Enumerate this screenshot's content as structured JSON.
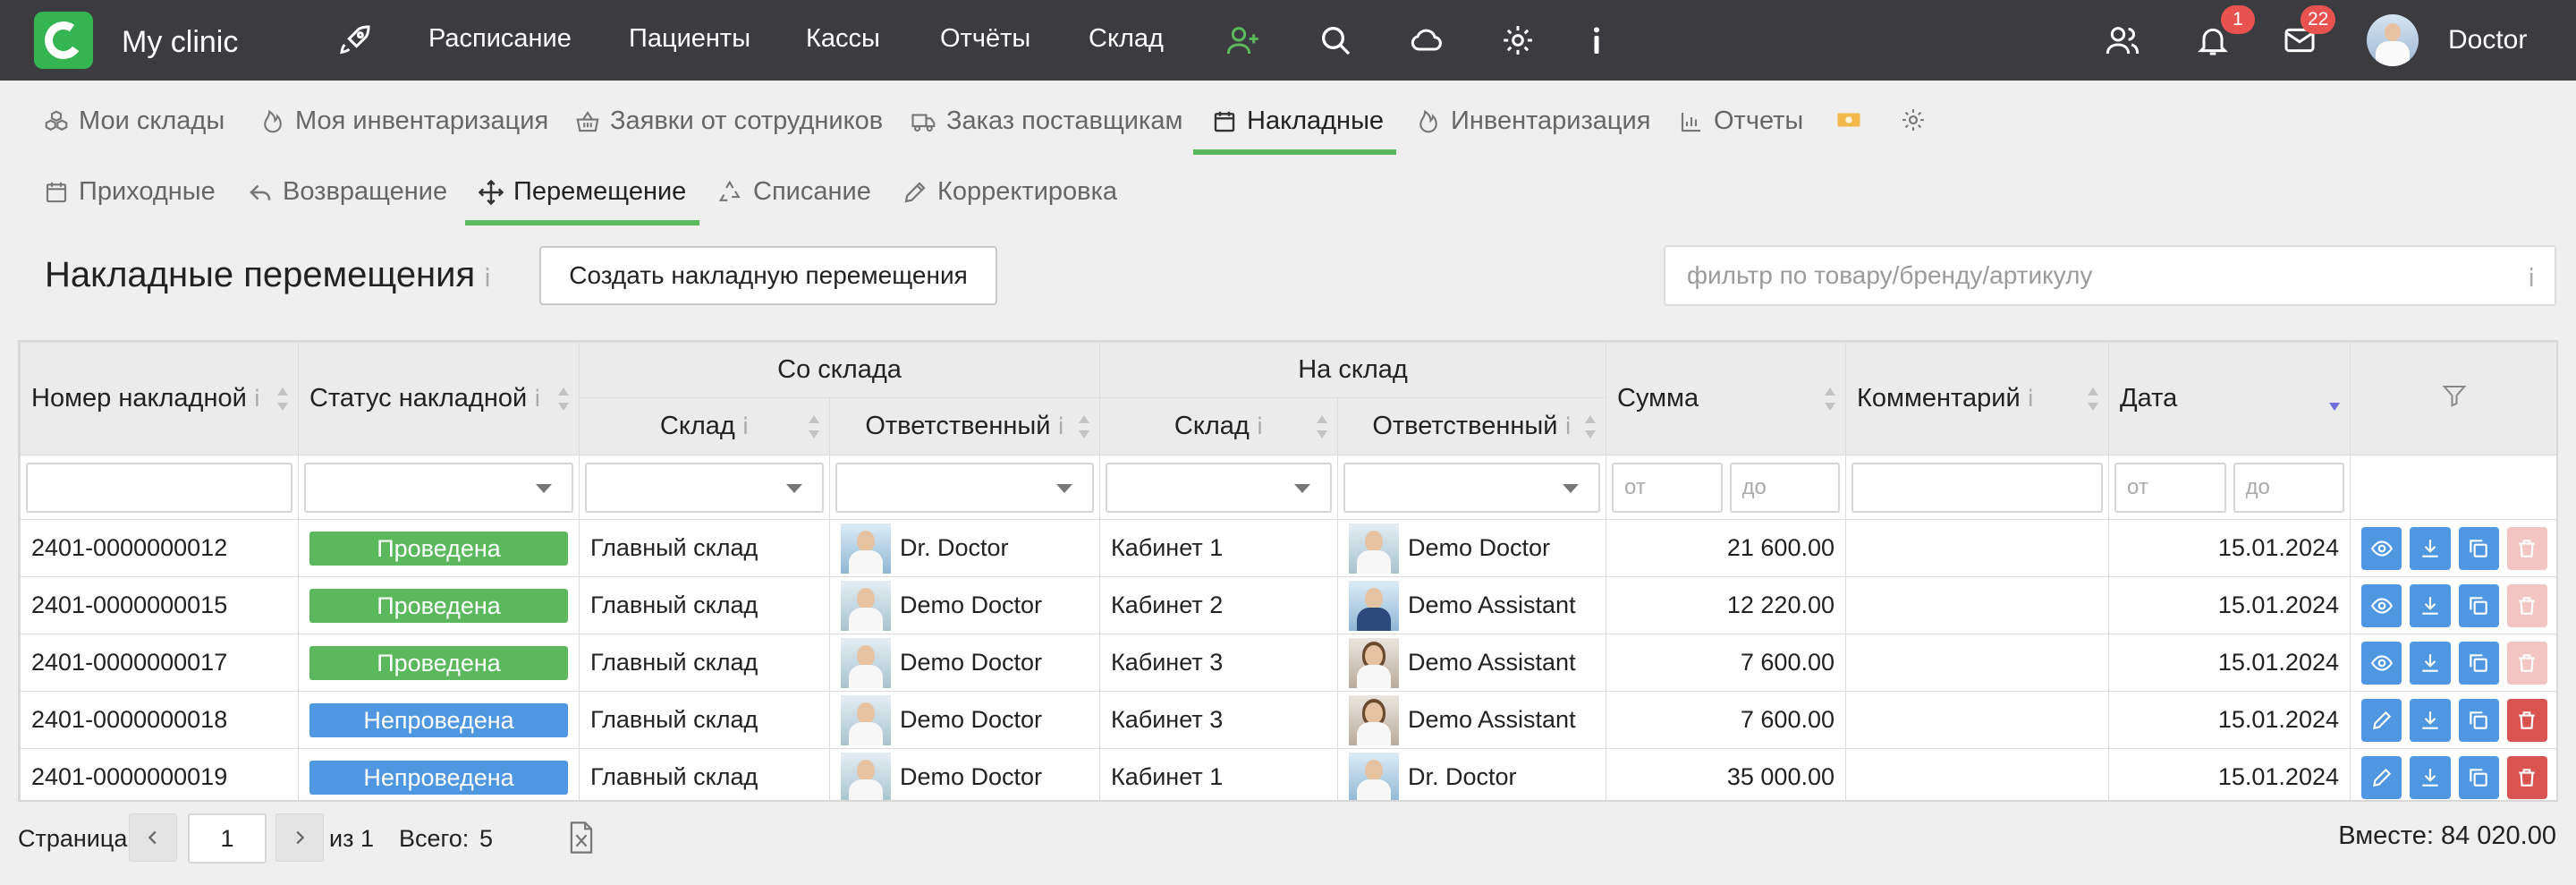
{
  "app": {
    "name": "My clinic",
    "user": "Doctor",
    "notifications_count": "1",
    "messages_count": "22"
  },
  "topnav": [
    "Расписание",
    "Пациенты",
    "Кассы",
    "Отчёты",
    "Склад"
  ],
  "tabs": [
    "Мои склады",
    "Моя инвентаризация",
    "Заявки от сотрудников",
    "Заказ поставщикам",
    "Накладные",
    "Инвентаризация",
    "Отчеты"
  ],
  "subtabs": [
    "Приходные",
    "Возвращение",
    "Перемещение",
    "Списание",
    "Корректировка"
  ],
  "page": {
    "title": "Накладные перемещения",
    "create_button": "Создать накладную перемещения",
    "filter_placeholder": "фильтр по товару/бренду/артикулу"
  },
  "table": {
    "headers": {
      "number": "Номер накладной",
      "status": "Статус накладной",
      "from_group": "Со склада",
      "to_group": "На склад",
      "warehouse": "Склад",
      "responsible": "Ответственный",
      "sum": "Сумма",
      "comment": "Комментарий",
      "date": "Дата"
    },
    "range_from": "от",
    "range_to": "до",
    "rows": [
      {
        "number": "2401-0000000012",
        "status": "Проведена",
        "from_wh": "Главный склад",
        "from_person": "Dr. Doctor",
        "to_wh": "Кабинет 1",
        "to_person": "Demo Doctor",
        "sum": "21 600.00",
        "comment": "",
        "date": "15.01.2024"
      },
      {
        "number": "2401-0000000015",
        "status": "Проведена",
        "from_wh": "Главный склад",
        "from_person": "Demo Doctor",
        "to_wh": "Кабинет 2",
        "to_person": "Demo Assistant",
        "sum": "12 220.00",
        "comment": "",
        "date": "15.01.2024"
      },
      {
        "number": "2401-0000000017",
        "status": "Проведена",
        "from_wh": "Главный склад",
        "from_person": "Demo Doctor",
        "to_wh": "Кабинет 3",
        "to_person": "Demo Assistant",
        "sum": "7 600.00",
        "comment": "",
        "date": "15.01.2024"
      },
      {
        "number": "2401-0000000018",
        "status": "Непроведена",
        "from_wh": "Главный склад",
        "from_person": "Demo Doctor",
        "to_wh": "Кабинет 3",
        "to_person": "Demo Assistant",
        "sum": "7 600.00",
        "comment": "",
        "date": "15.01.2024"
      },
      {
        "number": "2401-0000000019",
        "status": "Непроведена",
        "from_wh": "Главный склад",
        "from_person": "Demo Doctor",
        "to_wh": "Кабинет 1",
        "to_person": "Dr. Doctor",
        "sum": "35 000.00",
        "comment": "",
        "date": "15.01.2024"
      }
    ]
  },
  "pagination": {
    "page_label": "Страница",
    "current_page": "1",
    "of_label": "из 1",
    "total_label": "Всего:",
    "total_count": "5",
    "sum_total": "Вместе: 84 020.00"
  },
  "colors": {
    "topbar": "#3b3b40",
    "accent_green": "#5cb85c",
    "status_done": "#5cb85c",
    "status_not_done": "#4f97e0",
    "action_blue": "#4f97e0",
    "delete_red": "#d9534f"
  }
}
